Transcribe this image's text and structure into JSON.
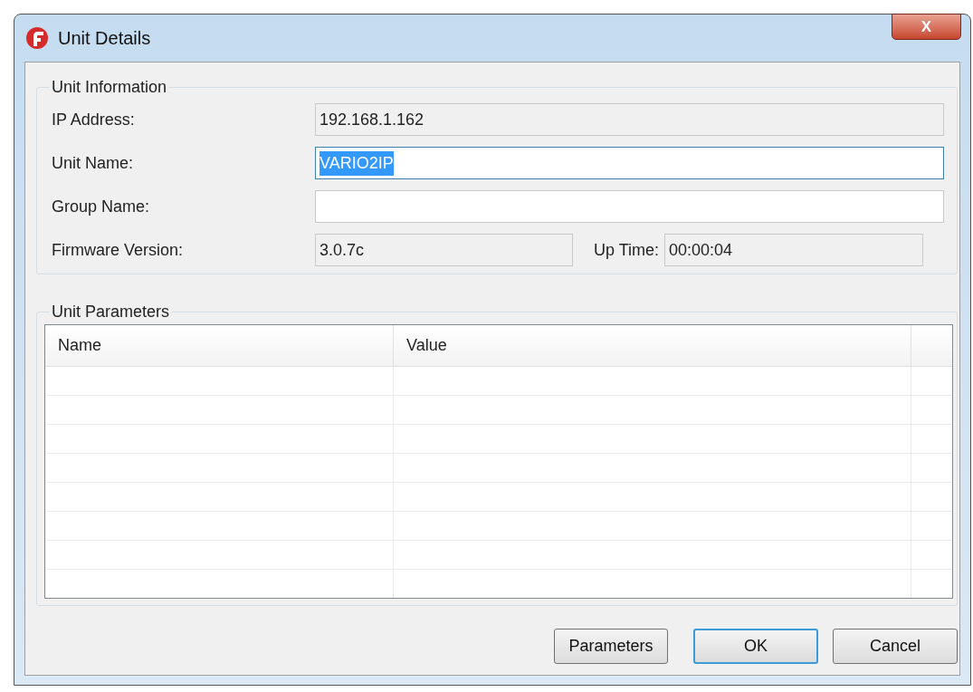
{
  "window": {
    "title": "Unit Details",
    "close_label": "X"
  },
  "unit_information": {
    "legend": "Unit Information",
    "fields": [
      {
        "kind": "readonly",
        "label": "IP Address:",
        "value": "192.168.1.162"
      },
      {
        "kind": "editable",
        "label": "Unit Name:",
        "value": "VARIO2IP",
        "focused": true,
        "text_selected": true
      },
      {
        "kind": "editable",
        "label": "Group Name:",
        "focused": false
      }
    ],
    "firmware": {
      "label": "Firmware Version:",
      "value": "3.0.7c"
    },
    "uptime": {
      "label": "Up Time:",
      "value": "00:00:04"
    }
  },
  "unit_parameters": {
    "legend": "Unit Parameters",
    "table": {
      "columns": [
        "Name",
        "Value"
      ]
    }
  },
  "buttons": [
    {
      "label": "Parameters",
      "default": false
    },
    {
      "label": "OK",
      "default": true
    },
    {
      "label": "Cancel",
      "default": false
    }
  ]
}
